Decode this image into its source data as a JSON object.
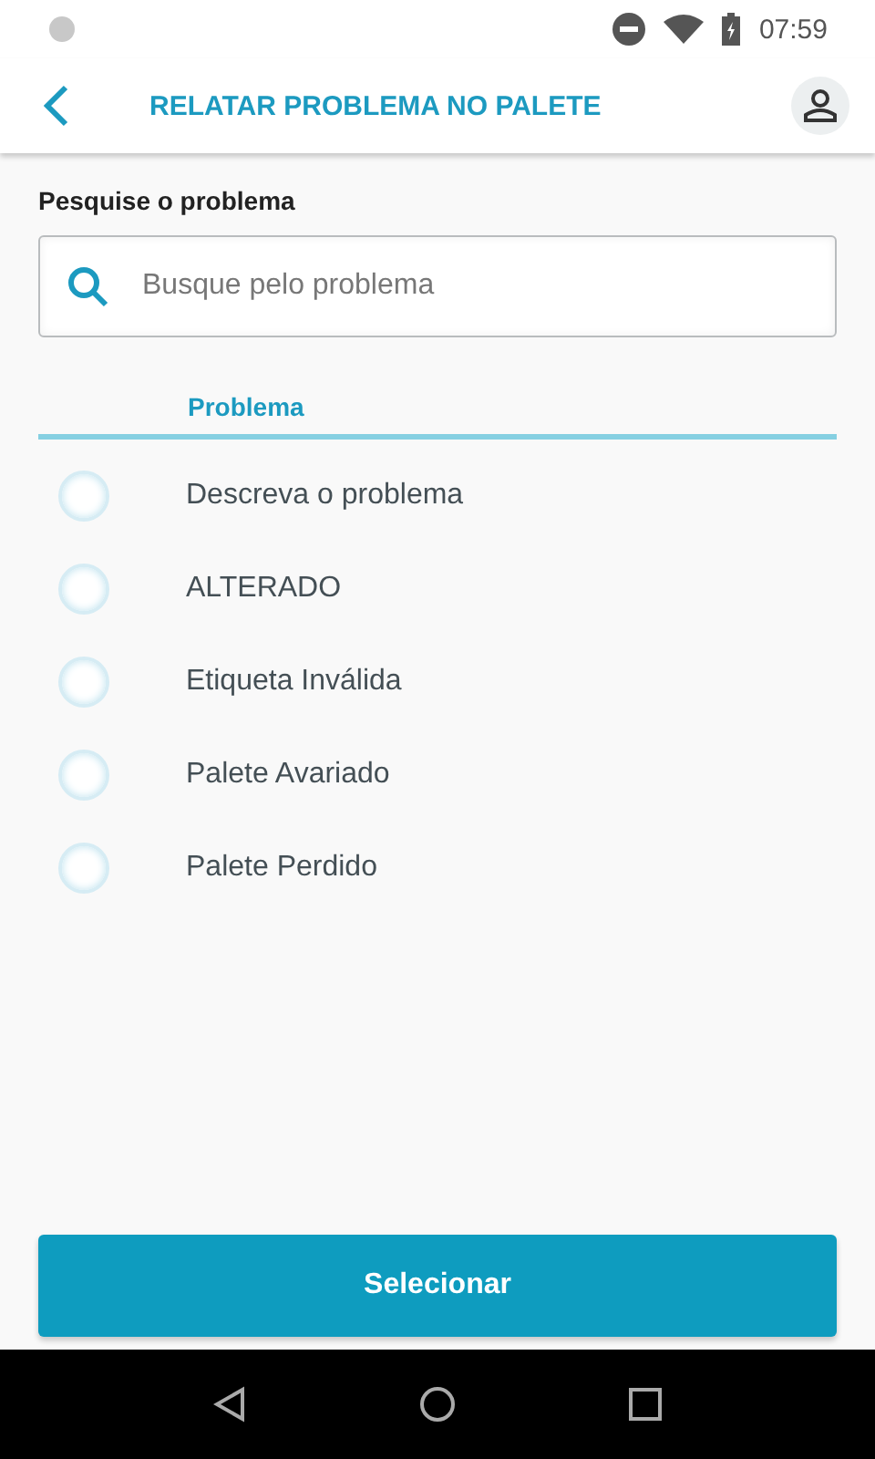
{
  "status_bar": {
    "time": "07:59"
  },
  "app_bar": {
    "title": "RELATAR PROBLEMA NO PALETE"
  },
  "search": {
    "label": "Pesquise o problema",
    "placeholder": "Busque pelo problema"
  },
  "list": {
    "header": "Problema",
    "items": [
      {
        "label": "Descreva o problema",
        "selected": false
      },
      {
        "label": "ALTERADO",
        "selected": false
      },
      {
        "label": "Etiqueta Inválida",
        "selected": false
      },
      {
        "label": "Palete Avariado",
        "selected": false
      },
      {
        "label": "Palete Perdido",
        "selected": false
      }
    ]
  },
  "primary_button": {
    "label": "Selecionar"
  }
}
